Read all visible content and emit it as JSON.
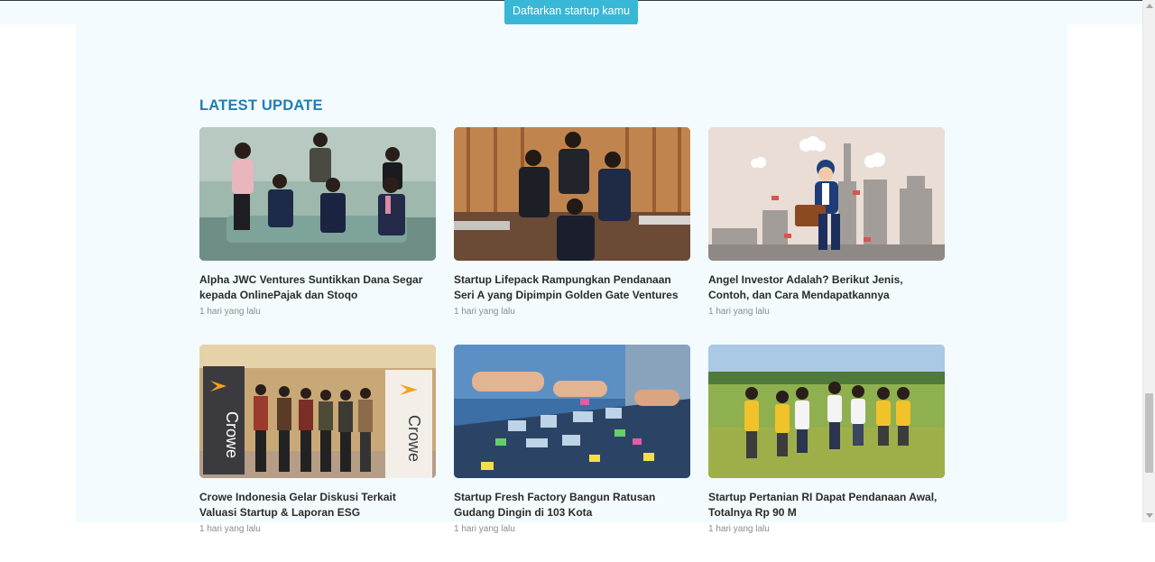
{
  "header": {
    "cta_label": "Daftarkan startup kamu"
  },
  "section": {
    "title": "LATEST UPDATE"
  },
  "articles": [
    {
      "title": "Alpha JWC Ventures Suntikkan Dana Segar kepada OnlinePajak dan Stoqo",
      "time": "1 hari yang lalu"
    },
    {
      "title": "Startup Lifepack Rampungkan Pendanaan Seri A yang Dipimpin Golden Gate Ventures",
      "time": "1 hari yang lalu"
    },
    {
      "title": "Angel Investor Adalah? Berikut Jenis, Contoh, dan Cara Mendapatkannya",
      "time": "1 hari yang lalu"
    },
    {
      "title": "Crowe Indonesia Gelar Diskusi Terkait Valuasi Startup & Laporan ESG",
      "time": "1 hari yang lalu"
    },
    {
      "title": "Startup Fresh Factory Bangun Ratusan Gudang Dingin di 103 Kota",
      "time": "1 hari yang lalu"
    },
    {
      "title": "Startup Pertanian RI Dapat Pendanaan Awal, Totalnya Rp 90 M",
      "time": "1 hari yang lalu"
    }
  ],
  "images": {
    "crowe_logo_text": "Crowe"
  }
}
